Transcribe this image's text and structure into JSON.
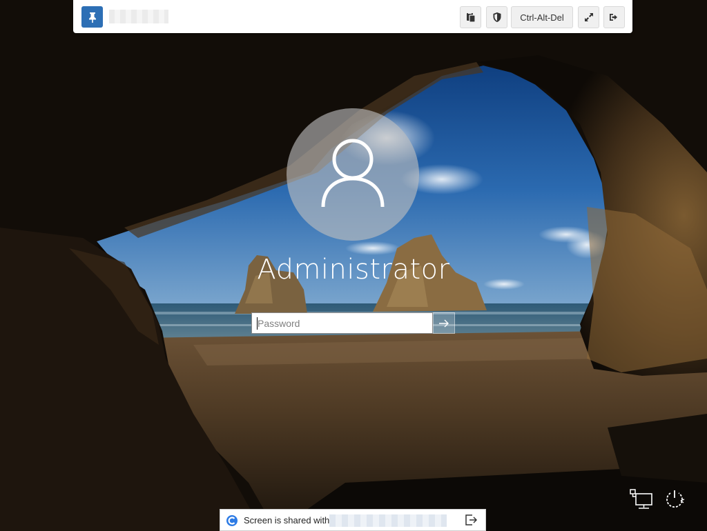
{
  "toolbar": {
    "pin_icon": "pin-icon",
    "clipboard_icon": "clipboard-icon",
    "shield_icon": "shield-icon",
    "ctrl_alt_del_label": "Ctrl-Alt-Del",
    "fullscreen_icon": "expand-icon",
    "exit_icon": "sign-out-icon"
  },
  "login": {
    "avatar_icon": "user-icon",
    "username": "Administrator",
    "password_placeholder": "Password",
    "submit_icon": "arrow-right-icon"
  },
  "corner_icons": {
    "network_icon": "network-icon",
    "power_icon": "power-icon"
  },
  "share_banner": {
    "text": "Screen is shared with",
    "exit_icon": "exit-icon"
  },
  "colors": {
    "accent": "#2d6fb5",
    "banner_logo": "#2d7be5"
  }
}
